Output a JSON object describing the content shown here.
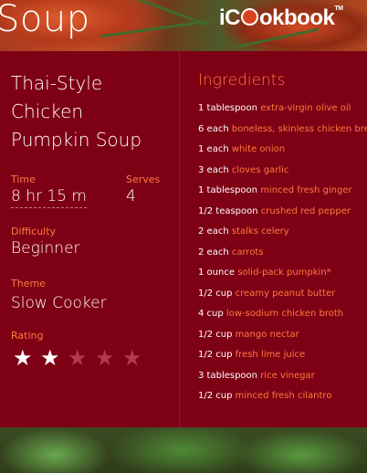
{
  "header": {
    "page_title": "Soup",
    "logo_text_a": "iC",
    "logo_text_b": "okbook",
    "logo_tm": "TM"
  },
  "recipe": {
    "title_lines": [
      "Thai-Style",
      "Chicken",
      "Pumpkin Soup"
    ],
    "time_label": "Time",
    "time_value": "8 hr 15 m",
    "serves_label": "Serves",
    "serves_value": "4",
    "difficulty_label": "Difficulty",
    "difficulty_value": "Beginner",
    "theme_label": "Theme",
    "theme_value": "Slow Cooker",
    "rating_label": "Rating",
    "rating_value": 2,
    "rating_max": 5
  },
  "ingredients": {
    "heading": "Ingredients",
    "items": [
      {
        "qty": "1 tablespoon",
        "name": "extra-virgin olive oil"
      },
      {
        "qty": "6 each",
        "name": "boneless, skinless chicken brea"
      },
      {
        "qty": "1 each",
        "name": "white onion"
      },
      {
        "qty": "3 each",
        "name": "cloves garlic"
      },
      {
        "qty": "1 tablespoon",
        "name": "minced fresh ginger"
      },
      {
        "qty": "1/2 teaspoon",
        "name": "crushed red pepper"
      },
      {
        "qty": "2 each",
        "name": "stalks celery"
      },
      {
        "qty": "2 each",
        "name": "carrots"
      },
      {
        "qty": "1 ounce",
        "name": "solid-pack pumpkin*"
      },
      {
        "qty": "1/2 cup",
        "name": "creamy peanut butter"
      },
      {
        "qty": "4 cup",
        "name": "low-sodium chicken broth"
      },
      {
        "qty": "1/2 cup",
        "name": "mango nectar"
      },
      {
        "qty": "1/2 cup",
        "name": "fresh lime juice"
      },
      {
        "qty": "3 tablespoon",
        "name": "rice vinegar"
      },
      {
        "qty": "1/2 cup",
        "name": "minced fresh cilantro"
      }
    ]
  },
  "icons": {
    "star_filled": "star-filled-icon",
    "star_empty": "star-empty-icon"
  }
}
